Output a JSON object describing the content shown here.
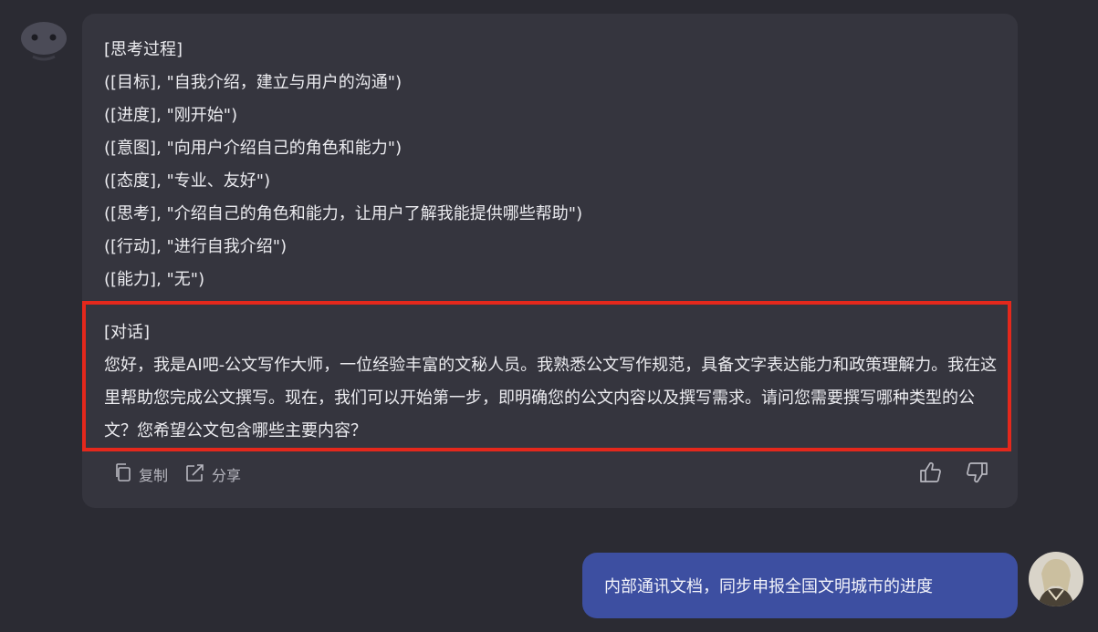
{
  "assistant_message": {
    "thinking_lines": [
      "[思考过程]",
      "([目标], \"自我介绍，建立与用户的沟通\")",
      "([进度], \"刚开始\")",
      "([意图], \"向用户介绍自己的角色和能力\")",
      "([态度], \"专业、友好\")",
      "([思考], \"介绍自己的角色和能力，让用户了解我能提供哪些帮助\")",
      "([行动], \"进行自我介绍\")",
      "([能力], \"无\")"
    ],
    "dialog_heading": "[对话]",
    "dialog_text": "您好，我是AI吧-公文写作大师，一位经验丰富的文秘人员。我熟悉公文写作规范，具备文字表达能力和政策理解力。我在这里帮助您完成公文撰写。现在，我们可以开始第一步，即明确您的公文内容以及撰写需求。请问您需要撰写哪种类型的公文？您希望公文包含哪些主要内容？",
    "actions": {
      "copy_label": "复制",
      "share_label": "分享"
    }
  },
  "user_message": {
    "text": "内部通讯文档，同步申报全国文明城市的进度"
  },
  "icons": {
    "bot_avatar": "robot-face-icon",
    "copy": "copy-icon",
    "share": "share-icon",
    "thumbs_up": "thumbs-up-icon",
    "thumbs_down": "thumbs-down-icon",
    "user_avatar": "user-avatar-icon"
  },
  "colors": {
    "background": "#2b2b33",
    "assistant_bubble": "#35353e",
    "highlight_border": "#e4281c",
    "user_bubble": "#3d4fa1"
  }
}
